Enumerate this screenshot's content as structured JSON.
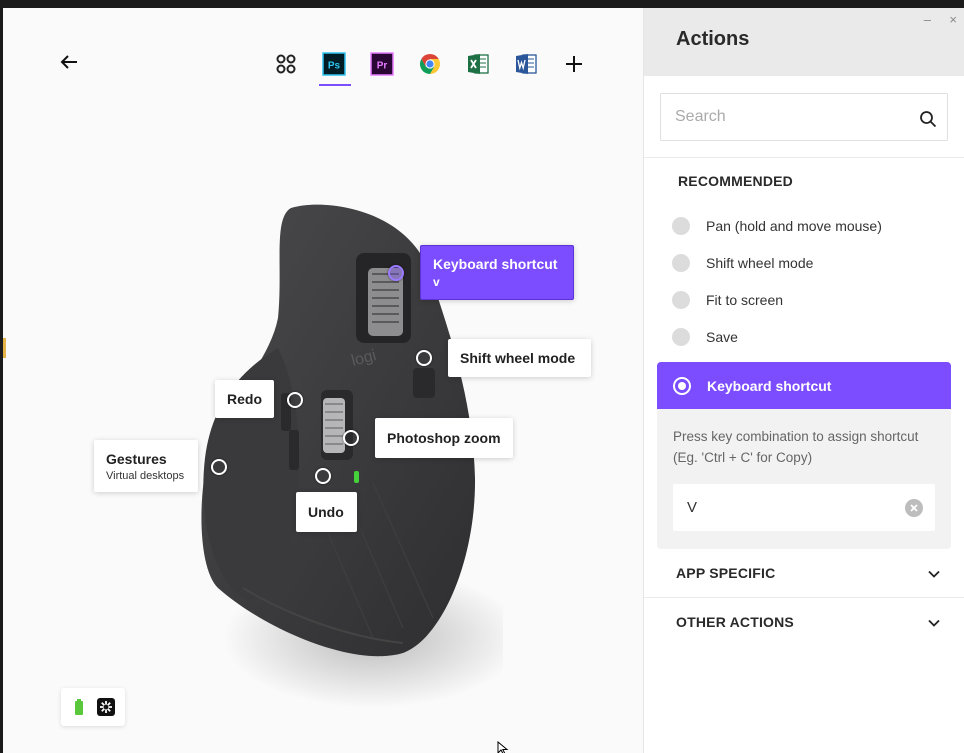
{
  "tabs": [
    {
      "name": "all-applications",
      "icon": "grid-icon",
      "selected": false
    },
    {
      "name": "photoshop",
      "icon": "photoshop-icon",
      "text": "Ps",
      "selected": true
    },
    {
      "name": "premiere",
      "icon": "premiere-icon",
      "text": "Pr",
      "selected": false
    },
    {
      "name": "chrome",
      "icon": "chrome-icon",
      "selected": false
    },
    {
      "name": "excel",
      "icon": "excel-icon",
      "selected": false
    },
    {
      "name": "word",
      "icon": "word-icon",
      "selected": false
    },
    {
      "name": "add-application",
      "icon": "plus-icon",
      "selected": false
    }
  ],
  "mouse": {
    "logo": "logi",
    "callouts": {
      "keyboard_shortcut": {
        "title": "Keyboard shortcut",
        "sub": "v"
      },
      "shift_wheel": {
        "title": "Shift wheel mode"
      },
      "redo": {
        "title": "Redo"
      },
      "photoshop_zoom": {
        "title": "Photoshop zoom"
      },
      "gestures": {
        "title": "Gestures",
        "sub": "Virtual desktops"
      },
      "undo": {
        "title": "Undo"
      }
    }
  },
  "status": {
    "battery_icon": "battery-icon",
    "connection_icon": "unifying-receiver-icon",
    "battery_color": "#5ac83c"
  },
  "panel": {
    "title": "Actions",
    "window_controls": {
      "minimize": "–",
      "close": "×"
    },
    "search": {
      "placeholder": "Search"
    },
    "recommended": {
      "label": "RECOMMENDED",
      "items": [
        "Pan (hold and move mouse)",
        "Shift wheel mode",
        "Fit to screen",
        "Save"
      ]
    },
    "selected": {
      "label": "Keyboard shortcut",
      "hint": "Press key combination to assign shortcut (Eg. 'Ctrl + C' for Copy)",
      "value": "V"
    },
    "app_specific": {
      "label": "APP SPECIFIC"
    },
    "other_actions": {
      "label": "OTHER ACTIONS"
    }
  },
  "colors": {
    "accent": "#7c4dff",
    "panel_header": "#eaeaea"
  }
}
